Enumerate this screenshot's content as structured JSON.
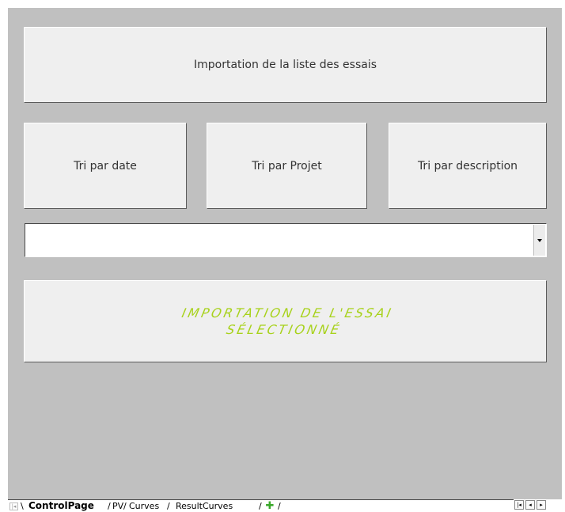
{
  "buttons": {
    "import_list": "Importation de la liste des essais",
    "sort_date": "Tri par date",
    "sort_project": "Tri par Projet",
    "sort_description": "Tri par description",
    "import_selected": "Importation de l'essai sélectionné"
  },
  "combo": {
    "value": ""
  },
  "sheet_tabs": {
    "active": "ControlPage",
    "tabs": [
      "PV",
      "Curves",
      "ResultCurves"
    ],
    "add_icon": "plus-icon"
  },
  "colors": {
    "canvas_bg": "#c0c0c0",
    "button_bg": "#efefef",
    "accent_text": "#a8d21c",
    "add_tab": "#3aa82a"
  }
}
